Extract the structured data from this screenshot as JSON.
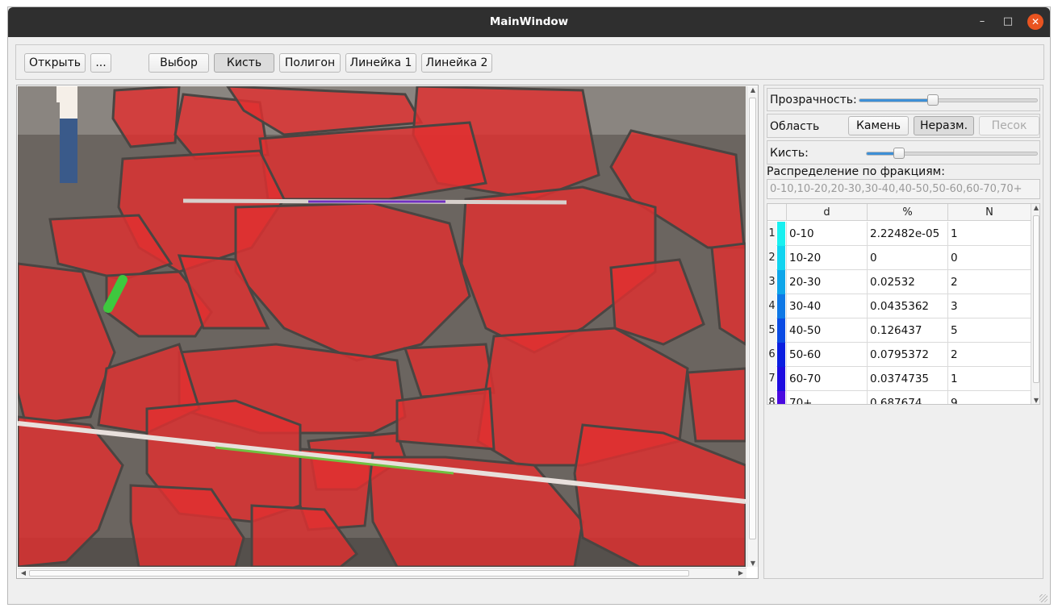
{
  "window": {
    "title": "MainWindow",
    "min_icon": "minimize-icon",
    "max_icon": "maximize-icon",
    "close_icon": "close-icon"
  },
  "toolbar": {
    "open_label": "Открыть",
    "more_label": "...",
    "select_label": "Выбор",
    "brush_label": "Кисть",
    "polygon_label": "Полигон",
    "ruler1_label": "Линейка 1",
    "ruler2_label": "Линейка 2",
    "active_tool": "Кисть"
  },
  "canvas": {
    "description_colors": {
      "stone_overlay": "#e03030",
      "brush_stroke": "#3ec83e",
      "ruler_line": "#7030c0"
    }
  },
  "side": {
    "transparency_label": "Прозрачность:",
    "transparency_value": 0.41,
    "area_label": "Область",
    "area_stone": "Камень",
    "area_unsized": "Неразм.",
    "area_sand": "Песок",
    "area_selected": "Неразм.",
    "brush_label": "Кисть:",
    "brush_value": 0.19,
    "distribution_label": "Распределение по фракциям:",
    "distribution_value": "0-10,10-20,20-30,30-40,40-50,50-60,60-70,70+"
  },
  "table": {
    "headers": {
      "d": "d",
      "pct": "%",
      "n": "N"
    },
    "rows": [
      {
        "num": "1",
        "d": "0-10",
        "pct": "2.22482e-05",
        "n": "1",
        "color": "#19f0f0"
      },
      {
        "num": "2",
        "d": "10-20",
        "pct": "0",
        "n": "0",
        "color": "#12d4f0"
      },
      {
        "num": "3",
        "d": "20-30",
        "pct": "0.02532",
        "n": "2",
        "color": "#0ea6ea"
      },
      {
        "num": "4",
        "d": "30-40",
        "pct": "0.0435362",
        "n": "3",
        "color": "#0e78e6"
      },
      {
        "num": "5",
        "d": "40-50",
        "pct": "0.126437",
        "n": "5",
        "color": "#0a4be4"
      },
      {
        "num": "6",
        "d": "50-60",
        "pct": "0.0795372",
        "n": "2",
        "color": "#0a1ee0"
      },
      {
        "num": "7",
        "d": "60-70",
        "pct": "0.0374735",
        "n": "1",
        "color": "#1e0ce0"
      },
      {
        "num": "8",
        "d": "70+",
        "pct": "0.687674",
        "n": "9",
        "color": "#4a0ae0"
      }
    ]
  }
}
